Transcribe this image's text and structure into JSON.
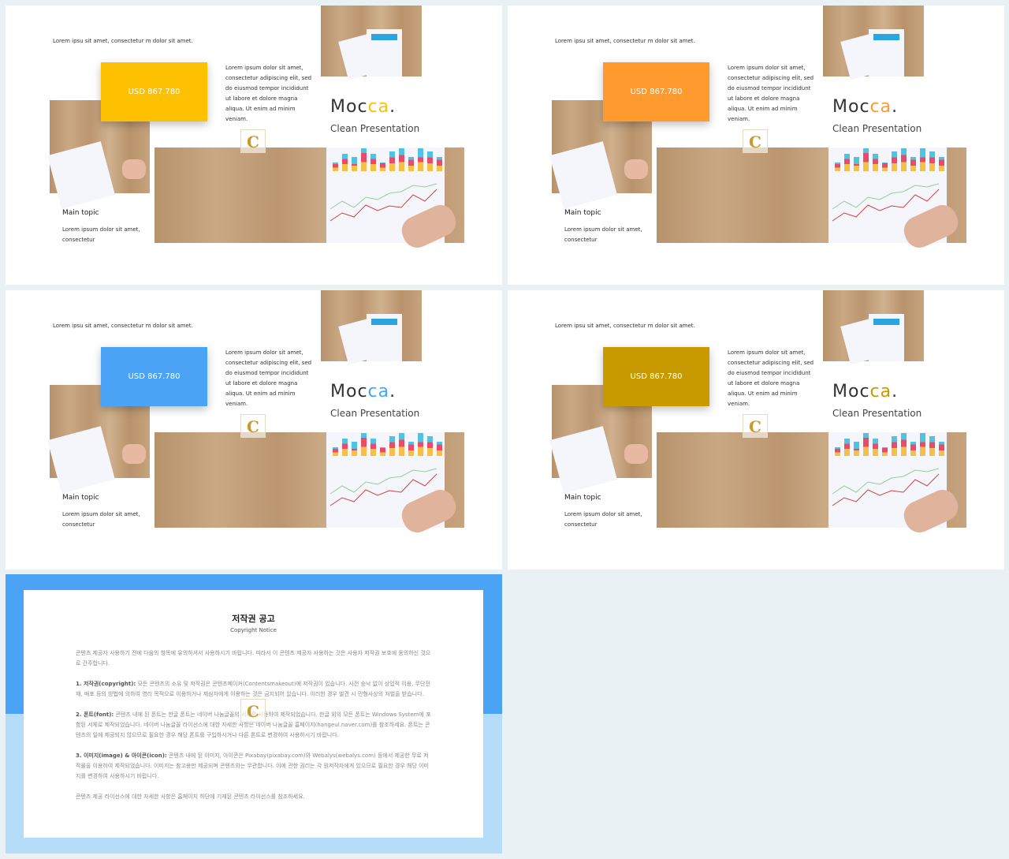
{
  "slides": [
    {
      "accent": "#fdc101",
      "top_text": "Lorem ipsu sit amet, consectetur m dolor sit amet.",
      "price": "USD 867.780",
      "paragraph": "Lorem ipsum dolor sit amet, consectetur adipiscing elit, sed do eiusmod tempor incididunt ut labore et dolore magna aliqua. Ut enim ad minim veniam.",
      "title_a": "Moc",
      "title_b": "ca",
      "title_dot": ".",
      "subtitle": "Clean Presentation",
      "main_topic": "Main topic",
      "main_text": "Lorem ipsum dolor sit amet, consectetur",
      "logo": "C"
    },
    {
      "accent": "#fe9a2e",
      "top_text": "Lorem ipsu sit amet, consectetur m dolor sit amet.",
      "price": "USD 867.780",
      "paragraph": "Lorem ipsum dolor sit amet, consectetur adipiscing elit, sed do eiusmod tempor incididunt ut labore et dolore magna aliqua. Ut enim ad minim veniam.",
      "title_a": "Moc",
      "title_b": "ca",
      "title_dot": ".",
      "subtitle": "Clean Presentation",
      "main_topic": "Main topic",
      "main_text": "Lorem ipsum dolor sit amet, consectetur",
      "logo": "C"
    },
    {
      "accent": "#4aa3f5",
      "top_text": "Lorem ipsu sit amet, consectetur m dolor sit amet.",
      "price": "USD 867.780",
      "paragraph": "Lorem ipsum dolor sit amet, consectetur adipiscing elit, sed do eiusmod tempor incididunt ut labore et dolore magna aliqua. Ut enim ad minim veniam.",
      "title_a": "Moc",
      "title_b": "ca",
      "title_dot": ".",
      "subtitle": "Clean Presentation",
      "main_topic": "Main topic",
      "main_text": "Lorem ipsum dolor sit amet, consectetur",
      "logo": "C"
    },
    {
      "accent": "#c99a00",
      "top_text": "Lorem ipsu sit amet, consectetur m dolor sit amet.",
      "price": "USD 867.780",
      "paragraph": "Lorem ipsum dolor sit amet, consectetur adipiscing elit, sed do eiusmod tempor incididunt ut labore et dolore magna aliqua. Ut enim ad minim veniam.",
      "title_a": "Moc",
      "title_b": "ca",
      "title_dot": ".",
      "subtitle": "Clean Presentation",
      "main_topic": "Main topic",
      "main_text": "Lorem ipsum dolor sit amet, consectetur",
      "logo": "C"
    }
  ],
  "notice": {
    "title": "저작권 공고",
    "subtitle": "Copyright Notice",
    "intro": "콘텐츠 제공자 사용하기 전에 다음의 항목에 유의하셔서 사용하시기 바랍니다. 따라서 이 콘텐츠 제공자 사용하는 것은 사용자 저작권 보호에 동의하신 것으로 간주합니다.",
    "items": [
      {
        "label": "1. 저작권(copyright):",
        "text": "모든 콘텐츠의 소유 및 저작권은 콘텐츠메이커(Contentsmakeout)에 저작권이 있습니다. 사전 승낙 없이 상업적 이용, 무단전재, 배포 등의 방법에 의하여 영리 목적으로 이용하거나 제삼자에게 이용하는 것은 금지되어 있습니다. 이러한 경우 발견 시 민형사상의 처벌을 받습니다."
      },
      {
        "label": "2. 폰트(font):",
        "text": "콘텐츠 내에 된 폰트는 한글 폰트는 네이버 나눔글꼴의 서체를 사용하여 제작되었습니다. 한글 외의 모든 폰트는 Windows System에 포함된 서체로 제작되었습니다. 네이버 나눔글꼴 라이선스에 대한 자세한 사항은 네이버 나눔글꼴 홈페이지(hangeul.naver.com)를 참조하세요. 폰트는 콘텐츠의 일에 제공되지 않으므로 필요한 경우 해당 폰트를 구입하시거나 다른 폰트로 변경하여 사용하시기 바랍니다."
      },
      {
        "label": "3. 이미지(image) & 아이콘(icon):",
        "text": "콘텐츠 내에 된 이미지, 아이콘은 Pixabay(pixabay.com)와 Webalys(webalys.com) 등에서 제공한 무료 저작물을 이용하여 제작되었습니다. 이미지는 참고용만 제공되며 콘텐츠와는 무관합니다. 이에 관한 권리는 각 원저작자에게 있으므로 필요한 경우 해당 이미지를 변경하여 사용하시기 바랍니다."
      }
    ],
    "footer": "콘텐츠 제공 라이선스에 대한 자세한 사항은 홈페이지 하단에 기재된 콘텐츠 라이선스를 참조하세요.",
    "logo": "C",
    "colors": {
      "top": "#4aa3f5",
      "bottom": "#b5ddf9"
    }
  }
}
